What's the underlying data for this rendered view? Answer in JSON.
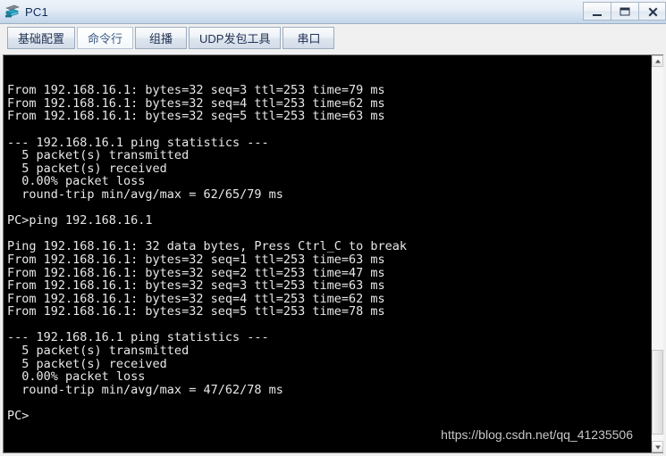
{
  "window": {
    "title": "PC1",
    "icon": "pc-host-icon",
    "controls": [
      {
        "name": "minimize-button",
        "glyph": "minimize-icon"
      },
      {
        "name": "maximize-button",
        "glyph": "maximize-icon"
      },
      {
        "name": "close-button",
        "glyph": "close-icon"
      }
    ]
  },
  "tabs": [
    {
      "label": "基础配置",
      "active": false
    },
    {
      "label": "命令行",
      "active": true
    },
    {
      "label": "组播",
      "active": false
    },
    {
      "label": "UDP发包工具",
      "active": false
    },
    {
      "label": "串口",
      "active": false
    }
  ],
  "terminal": {
    "background_color": "#000000",
    "text_color": "#e8e8e8",
    "prompt": "PC>",
    "lines": [
      "From 192.168.16.1: bytes=32 seq=3 ttl=253 time=79 ms",
      "From 192.168.16.1: bytes=32 seq=4 ttl=253 time=62 ms",
      "From 192.168.16.1: bytes=32 seq=5 ttl=253 time=63 ms",
      "",
      "--- 192.168.16.1 ping statistics ---",
      "  5 packet(s) transmitted",
      "  5 packet(s) received",
      "  0.00% packet loss",
      "  round-trip min/avg/max = 62/65/79 ms",
      "",
      "PC>ping 192.168.16.1",
      "",
      "Ping 192.168.16.1: 32 data bytes, Press Ctrl_C to break",
      "From 192.168.16.1: bytes=32 seq=1 ttl=253 time=63 ms",
      "From 192.168.16.1: bytes=32 seq=2 ttl=253 time=47 ms",
      "From 192.168.16.1: bytes=32 seq=3 ttl=253 time=63 ms",
      "From 192.168.16.1: bytes=32 seq=4 ttl=253 time=62 ms",
      "From 192.168.16.1: bytes=32 seq=5 ttl=253 time=78 ms",
      "",
      "--- 192.168.16.1 ping statistics ---",
      "  5 packet(s) transmitted",
      "  5 packet(s) received",
      "  0.00% packet loss",
      "  round-trip min/avg/max = 47/62/78 ms",
      "",
      "PC>"
    ]
  },
  "watermark": {
    "text": "https://blog.csdn.net/qq_41235506"
  }
}
